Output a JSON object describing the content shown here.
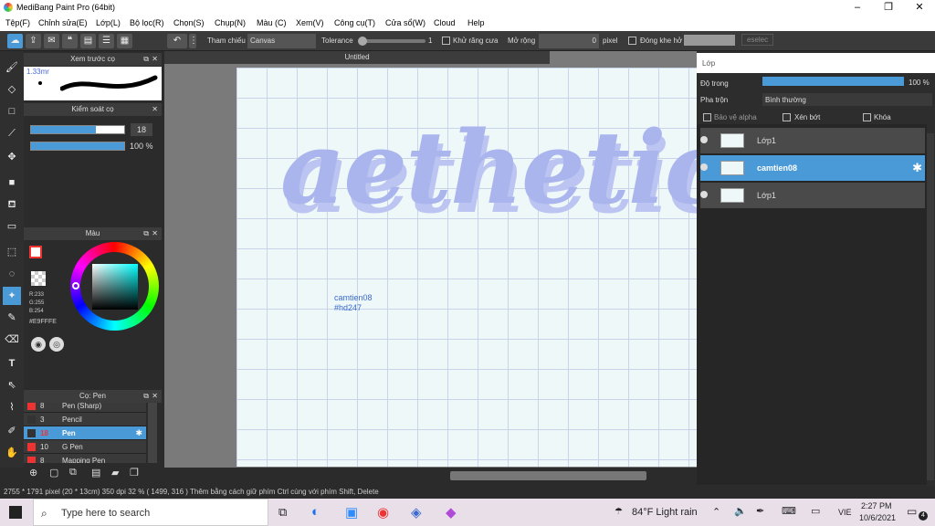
{
  "window": {
    "title": "MediBang Paint Pro (64bit)",
    "min": "–",
    "max": "❐",
    "close": "✕"
  },
  "menu": [
    "Tệp(F)",
    "Chỉnh sửa(E)",
    "Lớp(L)",
    "Bộ lọc(R)",
    "Chọn(S)",
    "Chụp(N)",
    "Màu (C)",
    "Xem(V)",
    "Công cụ(T)",
    "Cửa sổ(W)",
    "Cloud",
    "Help"
  ],
  "toolbar": {
    "reference_label": "Tham chiếu",
    "reference_value": "Canvas",
    "tolerance_label": "Tolerance",
    "tolerance_value": "1",
    "antialias_label": "Khử răng cưa",
    "expand_label": "Mở rộng",
    "expand_value": "0",
    "expand_unit": "pixel",
    "close_gap_label": "Đóng khe hở",
    "deselect_label": "eselec"
  },
  "preview_panel": {
    "title": "Xem trước cọ",
    "size": "1.33mr"
  },
  "brush_control": {
    "title": "Kiểm soát cọ",
    "size_value": "18",
    "opacity_value": "100 %",
    "size_fraction": 0.7,
    "opacity_fraction": 1.0
  },
  "color_panel": {
    "title": "Màu",
    "r": "R:233",
    "g": "G:255",
    "b": "B:254",
    "hex": "#E9FFFE"
  },
  "brush_panel": {
    "title": "Cọ: Pen",
    "items": [
      {
        "size": "8",
        "name": "Pen (Sharp)",
        "color": "#e33"
      },
      {
        "size": "3",
        "name": "Pencil",
        "color": "#333"
      },
      {
        "size": "18",
        "name": "Pen",
        "color": "#333",
        "selected": true
      },
      {
        "size": "10",
        "name": "G Pen",
        "color": "#e33"
      },
      {
        "size": "8",
        "name": "Mapping Pen",
        "color": "#e33"
      }
    ]
  },
  "canvas": {
    "tab_title": "Untitled",
    "big_text": "aethetic",
    "signature_line1": "camtien08",
    "signature_line2": "#hd247"
  },
  "layer_panel": {
    "title": "Lớp",
    "opacity_label": "Độ trong",
    "opacity_value": "100 %",
    "opacity_fraction": 1.0,
    "blend_label": "Pha trộn",
    "blend_value": "Bình thường",
    "protect_alpha": "Bảo vệ alpha",
    "clipping": "Xén bớt",
    "lock": "Khóa",
    "layers": [
      {
        "name": "Lớp1",
        "selected": false
      },
      {
        "name": "camtien08",
        "selected": true
      },
      {
        "name": "Lớp1",
        "selected": false
      }
    ]
  },
  "status": {
    "text": "2755 * 1791 pixel (20 * 13cm) 350 dpi 32 % ( 1499, 316 ) Thêm bằng cách giữ phím Ctrl cùng với phím Shift, Delete"
  },
  "taskbar": {
    "search_placeholder": "Type here to search",
    "weather": "84°F Light rain",
    "lang": "VIE",
    "time": "2:27 PM",
    "date": "10/6/2021",
    "notif": "4"
  },
  "colors": {
    "accent": "#4a9ad8",
    "selected_layer": "#4a9ad8",
    "canvas_text": "#aab5ee"
  }
}
